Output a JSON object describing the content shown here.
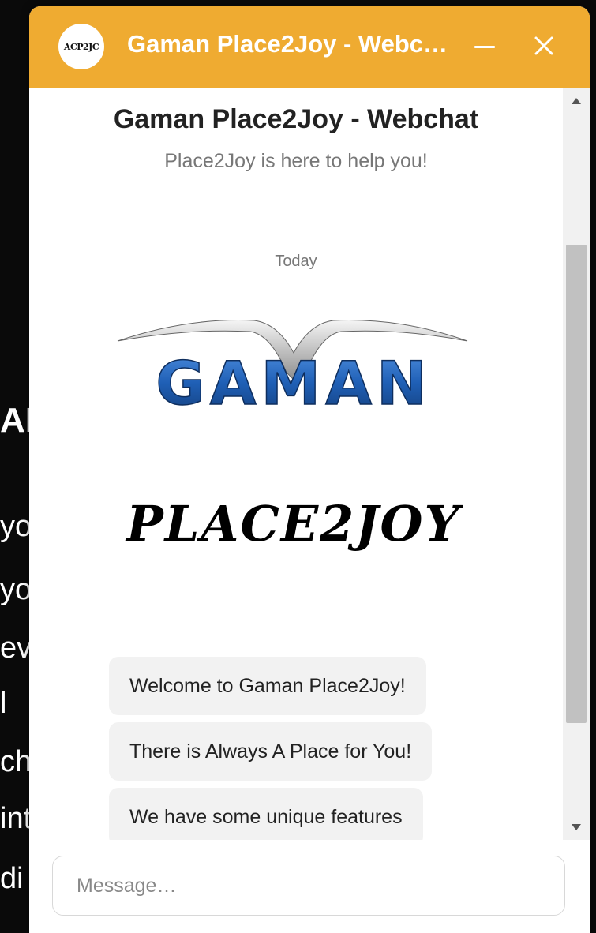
{
  "background": {
    "heading_fragment": "AI",
    "line_fragments": [
      "yo",
      "yo",
      "ev",
      "l",
      "ch",
      "int",
      "di"
    ]
  },
  "widget": {
    "header": {
      "avatar_text": "ACP2JC",
      "title": "Gaman Place2Joy - Webchat",
      "minimize_icon": "minimize-icon",
      "close_icon": "close-icon"
    },
    "body": {
      "title": "Gaman Place2Joy - Webchat",
      "subtitle": "Place2Joy is here to help you!",
      "day_label": "Today",
      "logo_gaman_text": "GAMAN",
      "logo_place2joy_text": "PLACE2JOY",
      "messages": [
        "Welcome to Gaman Place2Joy!",
        "There is Always A Place for You!",
        "We have some unique features"
      ]
    },
    "footer": {
      "placeholder": "Message…"
    },
    "colors": {
      "header_bg": "#efab31",
      "bubble_bg": "#f2f2f2",
      "gaman_blue": "#1f5fb5"
    }
  }
}
